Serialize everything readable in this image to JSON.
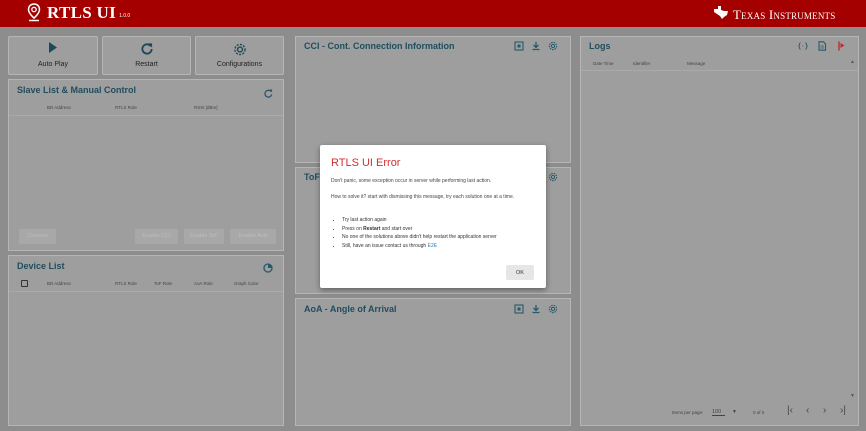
{
  "header": {
    "app_title": "RTLS UI",
    "version": "1.0.0",
    "company": "Texas Instruments"
  },
  "toolbar": {
    "auto_play": "Auto Play",
    "restart": "Restart",
    "configurations": "Configurations"
  },
  "slave_list": {
    "title": "Slave List & Manual Control",
    "columns": [
      "BD Address",
      "RTLS Role",
      "RSSI [dBm]"
    ],
    "buttons": {
      "connect": "Connect",
      "enable_cci": "Enable CCI",
      "enable_tof": "Enable ToF",
      "enable_aoa": "Enable AoA"
    }
  },
  "device_list": {
    "title": "Device List",
    "columns": [
      "BD Address",
      "RTLS Role",
      "ToF Role",
      "AoA Role",
      "Graph Color"
    ]
  },
  "cci_panel": {
    "title": "CCI - Cont. Connection Information"
  },
  "tof_panel": {
    "title": "ToF"
  },
  "aoa_panel": {
    "title": "AoA - Angle of Arrival"
  },
  "logs": {
    "title": "Logs",
    "columns": [
      "Date Time",
      "Identifier",
      "Message"
    ],
    "items_per_page_label": "Items per page:",
    "items_per_page_value": "100",
    "range": "0 of 0"
  },
  "dialog": {
    "title": "RTLS UI Error",
    "message1": "Don't panic, some exception occur in server while performing last action.",
    "message2": "How to solve it? start with dismissing this message, try each solution one at a time.",
    "item1": "Try last action again",
    "item2_prefix": "Press on ",
    "item2_bold": "Restart",
    "item2_suffix": " and start over",
    "item3": "No one of the solutions above didn't help restart the application server",
    "item4_prefix": "Still, have an issue contact us through ",
    "item4_link": "E2E",
    "ok_label": "OK"
  },
  "colors": {
    "header_red": "#a40000",
    "title_teal": "#1f4e5e",
    "error_red": "#d32f2f",
    "icon_teal": "#26596a"
  }
}
